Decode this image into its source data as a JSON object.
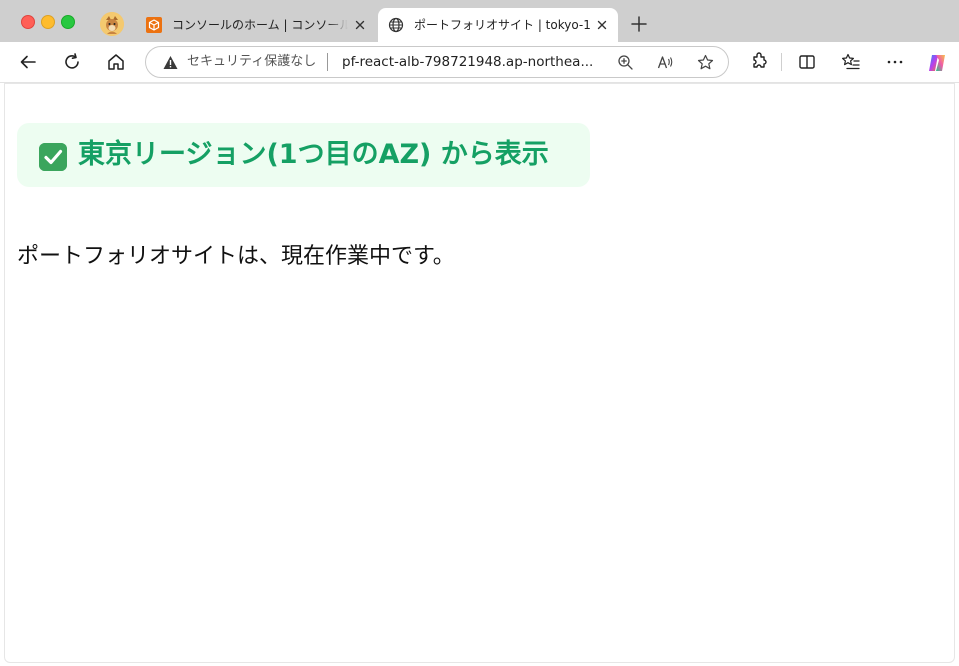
{
  "browser": {
    "tabs": [
      {
        "title": "コンソールのホーム | コンソールのホーム",
        "favicon": "aws-console-icon",
        "active": false
      },
      {
        "title": "ポートフォリオサイト | tokyo-1",
        "favicon": "globe-icon",
        "active": true
      }
    ],
    "address_bar": {
      "security_label": "セキュリティ保護なし",
      "url": "pf-react-alb-798721948.ap-northea..."
    }
  },
  "page": {
    "banner_emoji": "✅",
    "banner_text": "東京リージョン(1つ目のAZ) から表示",
    "status_text": "ポートフォリオサイトは、現在作業中です。"
  },
  "colors": {
    "banner_text": "#15a064",
    "banner_bg": "#edfdf1",
    "check_bg": "#3ba55d"
  }
}
